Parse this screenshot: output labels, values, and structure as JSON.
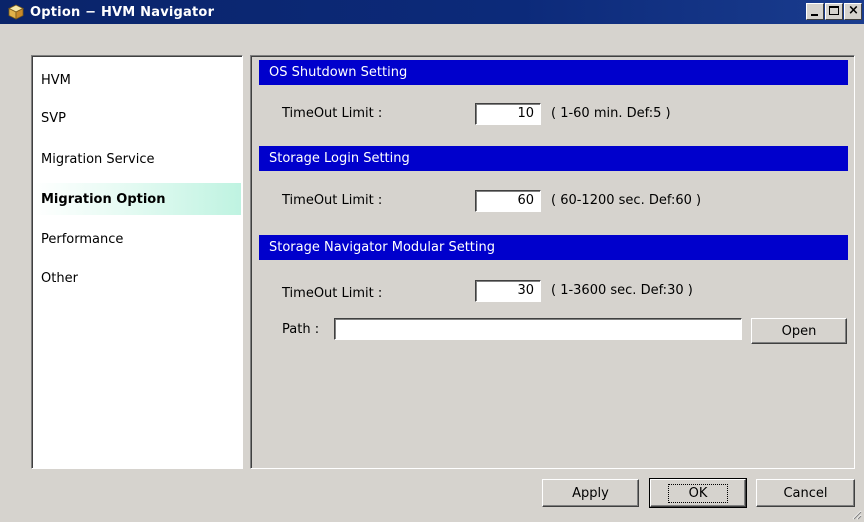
{
  "window": {
    "title": "Option − HVM Navigator",
    "icon": "app-cube-icon",
    "controls": {
      "minimize": "minimize-icon",
      "maximize": "maximize-icon",
      "close": "close-icon",
      "close_glyph": "×"
    }
  },
  "sidebar": {
    "items": [
      {
        "label": "HVM"
      },
      {
        "label": "SVP"
      },
      {
        "label": "Migration Service"
      },
      {
        "label": "Migration Option"
      },
      {
        "label": "Performance"
      },
      {
        "label": "Other"
      }
    ],
    "selected": "Migration Option"
  },
  "sections": {
    "os_shutdown": {
      "header": "OS Shutdown Setting",
      "timeout_label": "TimeOut Limit :",
      "timeout_value": "10",
      "hint": "( 1-60 min. Def:5 )"
    },
    "storage_login": {
      "header": "Storage Login Setting",
      "timeout_label": "TimeOut Limit :",
      "timeout_value": "60",
      "hint": "( 60-1200 sec. Def:60 )"
    },
    "storage_navigator": {
      "header": "Storage Navigator Modular Setting",
      "timeout_label": "TimeOut Limit :",
      "timeout_value": "30",
      "hint": "( 1-3600 sec. Def:30 )",
      "path_label": "Path :",
      "path_value": "",
      "open_label": "Open"
    }
  },
  "buttons": {
    "apply": "Apply",
    "ok": "OK",
    "cancel": "Cancel"
  },
  "colors": {
    "title_bar": "#0a246a",
    "section_header": "#0000cc",
    "dialog_bg": "#d6d3ce",
    "selected_item": "#bff3e1"
  }
}
